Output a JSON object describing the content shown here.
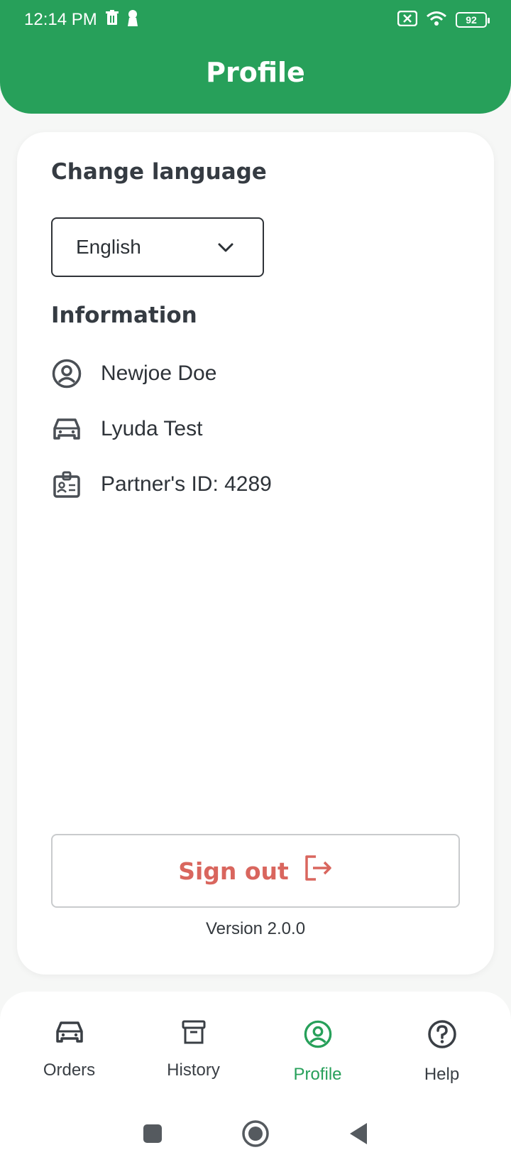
{
  "status_bar": {
    "time": "12:14 PM",
    "battery": "92",
    "icons": [
      "trash-icon",
      "keyhole-icon",
      "sim-off-icon",
      "wifi-icon",
      "battery-icon"
    ]
  },
  "header": {
    "title": "Profile"
  },
  "language": {
    "title": "Change language",
    "selected": "English"
  },
  "information": {
    "title": "Information",
    "items": [
      {
        "icon": "user-circle-icon",
        "text": "Newjoe Doe"
      },
      {
        "icon": "car-icon",
        "text": "Lyuda Test"
      },
      {
        "icon": "id-badge-icon",
        "text": "Partner's ID: 4289"
      }
    ]
  },
  "signout": {
    "label": "Sign out"
  },
  "version": "Version 2.0.0",
  "nav": {
    "items": [
      {
        "icon": "car-icon",
        "label": "Orders"
      },
      {
        "icon": "archive-icon",
        "label": "History"
      },
      {
        "icon": "user-circle-icon",
        "label": "Profile",
        "active": true
      },
      {
        "icon": "help-icon",
        "label": "Help"
      }
    ]
  },
  "colors": {
    "brand_green": "#27a05a",
    "signout_red": "#d9665e",
    "text_dark": "#333a40"
  }
}
